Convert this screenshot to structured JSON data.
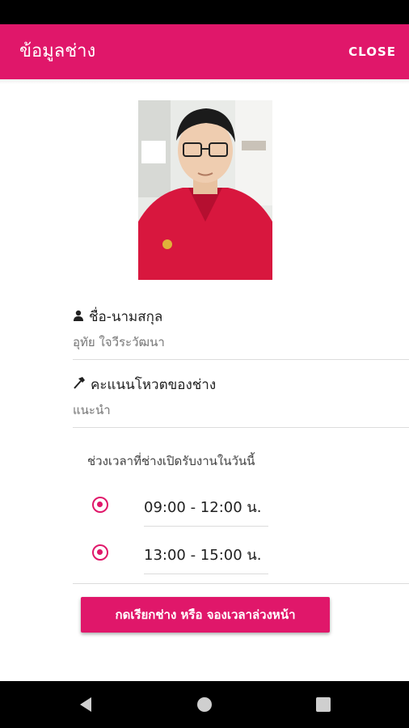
{
  "header": {
    "title": "ข้อมูลช่าง",
    "close_label": "CLOSE"
  },
  "technician": {
    "name_label": "ชื่อ-นามสกุล",
    "name_value": "อุทัย ใจวีระวัฒนา",
    "vote_label": "คะแนนโหวตของช่าง",
    "vote_value": "แนะนำ"
  },
  "availability": {
    "title": "ช่วงเวลาที่ช่างเปิดรับงานในวันนี้",
    "slots": [
      {
        "time": "09:00 - 12:00 น.",
        "selected": true
      },
      {
        "time": "13:00 - 15:00 น.",
        "selected": true
      }
    ]
  },
  "actions": {
    "book_label": "กดเรียกช่าง หรือ จองเวลาล่วงหน้า"
  },
  "colors": {
    "accent": "#E0176A"
  },
  "icons": {
    "name": "person-icon",
    "vote": "hammer-icon",
    "nav": [
      "back-icon",
      "home-icon",
      "recents-icon"
    ]
  }
}
